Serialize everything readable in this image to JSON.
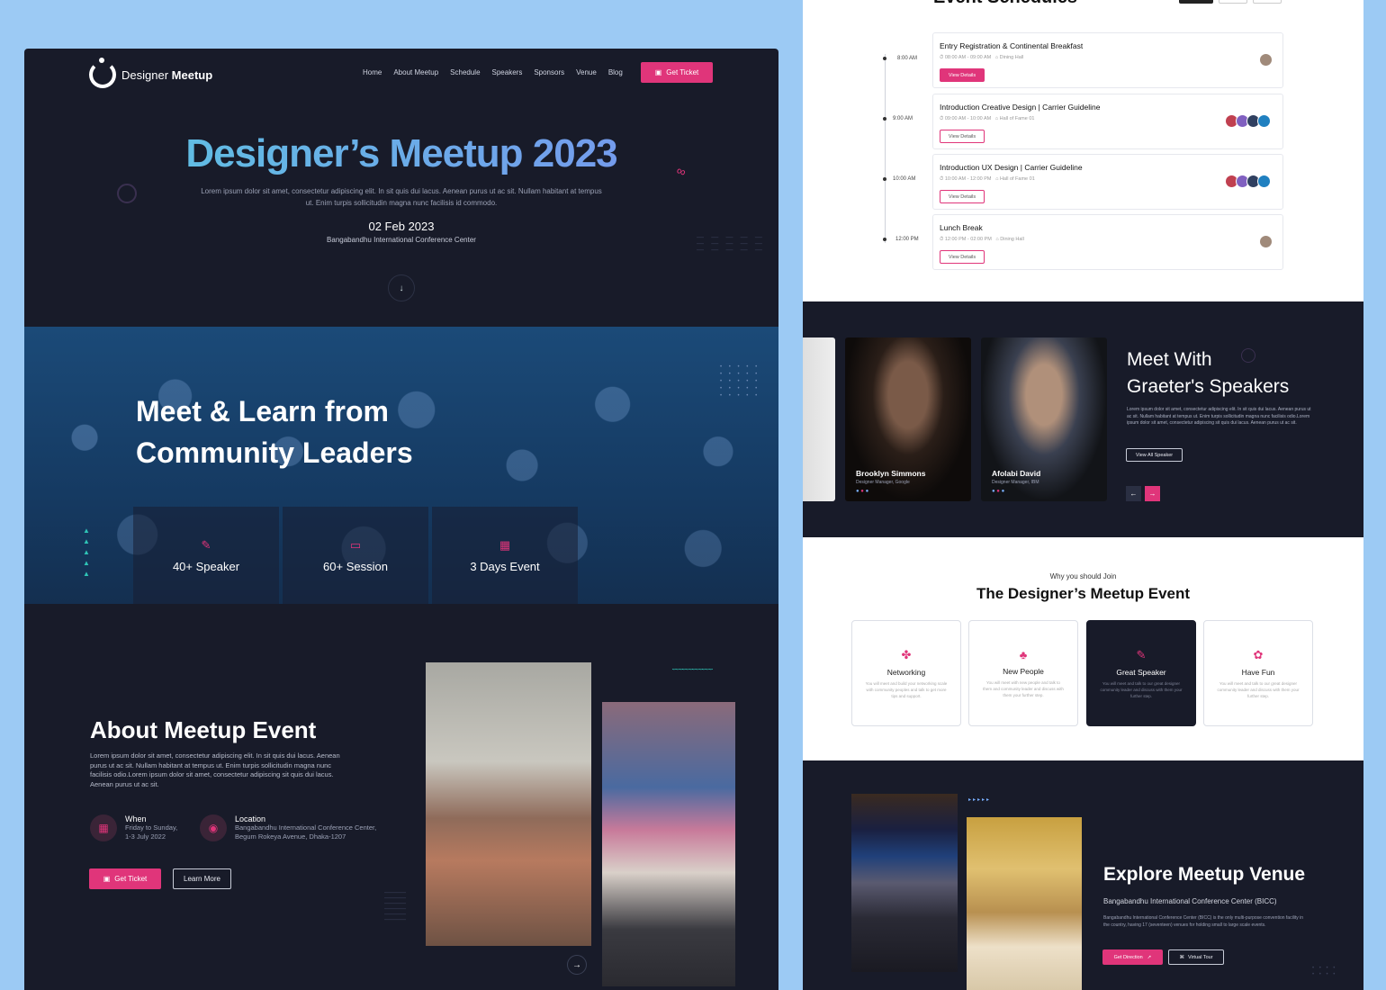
{
  "brand": {
    "name_regular": "Designer",
    "name_bold": "Meetup"
  },
  "nav": {
    "items": [
      "Home",
      "About Meetup",
      "Schedule",
      "Speakers",
      "Sponsors",
      "Venue",
      "Blog"
    ],
    "cta": "Get Ticket"
  },
  "hero": {
    "title": "Designer’s Meetup 2023",
    "description": "Lorem ipsum dolor sit amet, consectetur adipiscing elit. In sit quis dui lacus. Aenean purus ut ac sit. Nullam habitant at tempus ut. Enim turpis sollicitudin magna nunc facilisis id commodo.",
    "date": "02 Feb 2023",
    "venue": "Bangabandhu International Conference Center"
  },
  "community": {
    "title_line1": "Meet & Learn from",
    "title_line2": "Community Leaders",
    "stats": [
      {
        "icon": "microphone-icon",
        "label": "40+ Speaker"
      },
      {
        "icon": "monitor-icon",
        "label": "60+ Session"
      },
      {
        "icon": "calendar-icon",
        "label": "3 Days Event"
      }
    ]
  },
  "about": {
    "title": "About Meetup Event",
    "description": "Lorem ipsum dolor sit amet, consectetur adipiscing elit. In sit quis dui lacus. Aenean purus ut ac sit. Nullam habitant at tempus ut. Enim turpis sollicitudin magna nunc facilisis odio.Lorem ipsum dolor sit amet, consectetur adipiscing sit quis dui lacus. Aenean purus ut ac sit.",
    "when_label": "When",
    "when_line1": "Friday to Sunday,",
    "when_line2": "1-3 July 2022",
    "location_label": "Location",
    "location_line1": "Bangabandhu International Conference Center,",
    "location_line2": "Begum Rokeya Avenue, Dhaka-1207",
    "ticket_btn": "Get Ticket",
    "learn_btn": "Learn More"
  },
  "schedule": {
    "title": "Event Schedules",
    "items": [
      {
        "time": "8:00 AM",
        "title": "Entry Registration & Continental Breakfast",
        "hours": "08:00 AM - 09:00 AM",
        "place": "Dining Hall",
        "btn": "View Details"
      },
      {
        "time": "9:00 AM",
        "title": "Introduction Creative Design | Carrier Guideline",
        "hours": "09:00 AM - 10:00 AM",
        "place": "Hall of Fame 01",
        "btn": "View Details"
      },
      {
        "time": "10:00 AM",
        "title": "Introduction UX Design | Carrier Guideline",
        "hours": "10:00 AM - 12:00 PM",
        "place": "Hall of Fame 01",
        "btn": "View Details"
      },
      {
        "time": "12:00 PM",
        "title": "Lunch Break",
        "hours": "12:00 PM - 02:00 PM",
        "place": "Dining Hall",
        "btn": "View Details"
      }
    ]
  },
  "speakers": {
    "title_line1": "Meet With",
    "title_line2": "Graeter's Speakers",
    "description": "Lorem ipsum dolor sit amet, consectetur adipiscing elit. In sit quis dui lacus. Aenean purus ut ac sit. Nullam habitant at tempus ut. Enim turpis sollicitudin magna nunc facilisis odio.Lorem ipsum dolor sit amet, consectetur adipiscing sit quis dui lacus. Aenean purus ut ac sit.",
    "btn": "View All Speaker",
    "people": [
      {
        "name": "Brooklyn Simmons",
        "role": "Designer Manager, Google"
      },
      {
        "name": "Afolabi David",
        "role": "Designer Manager, IBM"
      }
    ]
  },
  "why": {
    "subtitle": "Why you should Join",
    "title": "The Designer’s Meetup Event",
    "features": [
      {
        "icon": "handshake-icon",
        "title": "Networking",
        "desc": "You will meet and build your networking scale with community peoples and talk to get more tips and support."
      },
      {
        "icon": "people-icon",
        "title": "New People",
        "desc": "You will meet with new people and talk to them and community leader and discuss with them your further step."
      },
      {
        "icon": "microphone-icon",
        "title": "Great Speaker",
        "desc": "You will meet and talk to our great designer community leader and discuss with them your further step."
      },
      {
        "icon": "paw-icon",
        "title": "Have Fun",
        "desc": "You will meet and talk to our great designer community leader and discuss with them your further step."
      }
    ]
  },
  "venue": {
    "title": "Explore Meetup Venue",
    "subtitle": "Bangabandhu International Conference Center (BICC)",
    "description": "Bangabandhu International Conference Center (BICC) is the only multi-purpose convention facility in the country, having 17 (seventeen) venues for holding small to large scale events.",
    "direction_btn": "Get Direction",
    "tour_btn": "Virtual Tour"
  },
  "colors": {
    "accent": "#e0357a",
    "dark_bg": "#181b29",
    "canvas": "#9ccaf4",
    "teal": "#2ec4b6"
  }
}
